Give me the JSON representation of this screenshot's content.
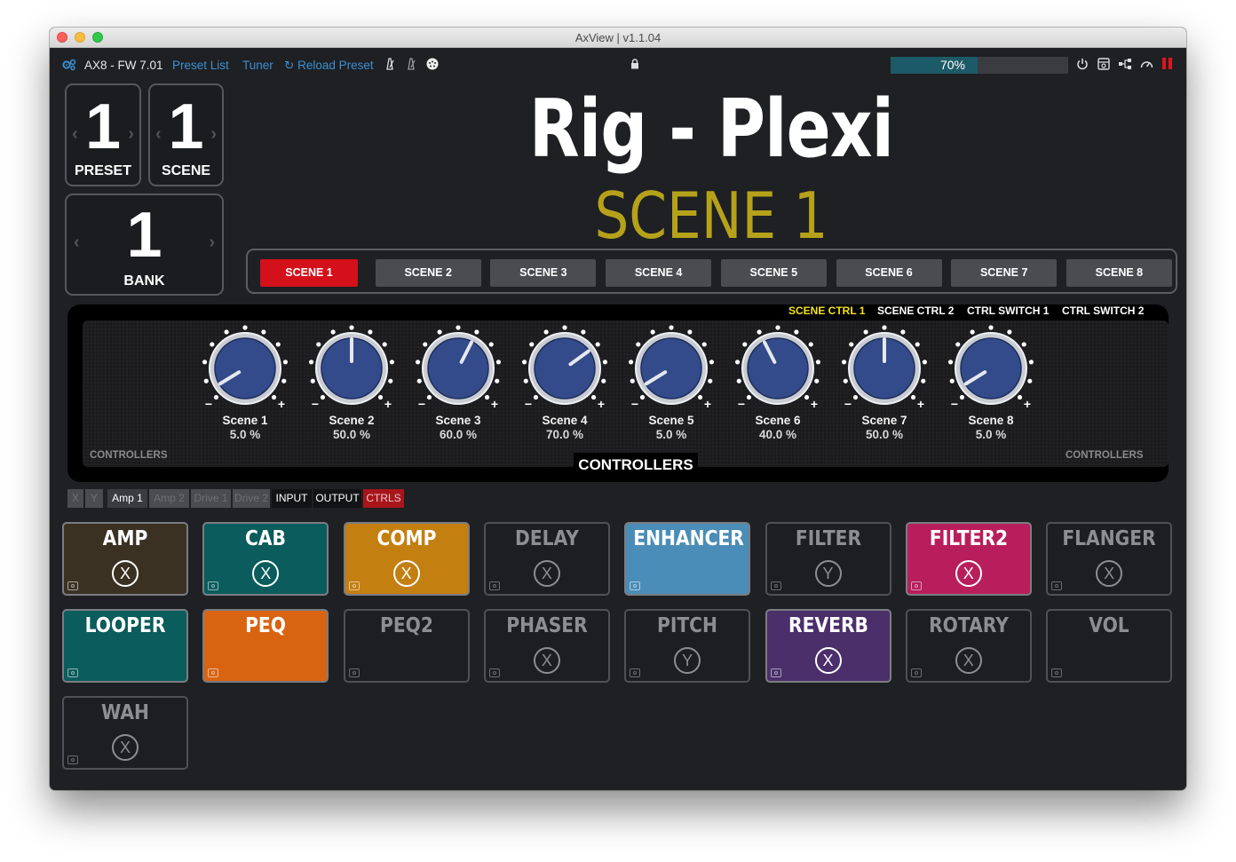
{
  "window": {
    "title": "AxView | v1.1.04"
  },
  "toolbar": {
    "device": "AX8 - FW 7.01",
    "preset_list": "Preset List",
    "tuner": "Tuner",
    "reload_icon": "refresh-icon",
    "reload_label": "Reload Preset",
    "progress_label": "70%",
    "progress_value": 70,
    "accent": "#3d8fd4"
  },
  "preset": {
    "value": "1",
    "label": "PRESET"
  },
  "scene": {
    "value": "1",
    "label": "SCENE"
  },
  "bank": {
    "value": "1",
    "label": "BANK"
  },
  "preset_name": "Rig - Plexi",
  "scene_name": "SCENE 1",
  "scene_buttons": [
    "SCENE 1",
    "SCENE 2",
    "SCENE 3",
    "SCENE 4",
    "SCENE 5",
    "SCENE 6",
    "SCENE 7",
    "SCENE 8"
  ],
  "scene_active_index": 0,
  "controller_tabs": [
    {
      "label": "SCENE CTRL 1",
      "active": true
    },
    {
      "label": "SCENE CTRL 2",
      "active": false
    },
    {
      "label": "CTRL SWITCH 1",
      "active": false
    },
    {
      "label": "CTRL SWITCH 2",
      "active": false
    }
  ],
  "controllers": {
    "corner_left": "CONTROLLERS",
    "corner_right": "CONTROLLERS",
    "center_label": "CONTROLLERS",
    "knobs": [
      {
        "label": "Scene 1",
        "value_text": "5.0 %",
        "value": 5.0
      },
      {
        "label": "Scene 2",
        "value_text": "50.0 %",
        "value": 50.0
      },
      {
        "label": "Scene 3",
        "value_text": "60.0 %",
        "value": 60.0
      },
      {
        "label": "Scene 4",
        "value_text": "70.0 %",
        "value": 70.0
      },
      {
        "label": "Scene 5",
        "value_text": "5.0 %",
        "value": 5.0
      },
      {
        "label": "Scene 6",
        "value_text": "40.0 %",
        "value": 40.0
      },
      {
        "label": "Scene 7",
        "value_text": "50.0 %",
        "value": 50.0
      },
      {
        "label": "Scene 8",
        "value_text": "5.0 %",
        "value": 5.0
      }
    ]
  },
  "chips": [
    {
      "label": "X",
      "state": "dim"
    },
    {
      "label": "Y",
      "state": "dim"
    },
    {
      "label": "Amp 1",
      "state": "on"
    },
    {
      "label": "Amp 2",
      "state": "dim"
    },
    {
      "label": "Drive 1",
      "state": "dim"
    },
    {
      "label": "Drive 2",
      "state": "dim"
    },
    {
      "label": "INPUT",
      "state": "plain"
    },
    {
      "label": "OUTPUT",
      "state": "plain"
    },
    {
      "label": "CTRLS",
      "state": "red"
    }
  ],
  "blocks": [
    {
      "name": "AMP",
      "xy": "X",
      "color": "#3b3122",
      "on": true
    },
    {
      "name": "CAB",
      "xy": "X",
      "color": "#0b5c5c",
      "on": true
    },
    {
      "name": "COMP",
      "xy": "X",
      "color": "#c47f11",
      "on": true
    },
    {
      "name": "DELAY",
      "xy": "X",
      "color": "",
      "on": false
    },
    {
      "name": "ENHANCER",
      "xy": "",
      "color": "#4a8db8",
      "on": true
    },
    {
      "name": "FILTER",
      "xy": "Y",
      "color": "",
      "on": false
    },
    {
      "name": "FILTER2",
      "xy": "X",
      "color": "#b81e5c",
      "on": true
    },
    {
      "name": "FLANGER",
      "xy": "X",
      "color": "",
      "on": false
    },
    {
      "name": "LOOPER",
      "xy": "",
      "color": "#0b5c5c",
      "on": true
    },
    {
      "name": "PEQ",
      "xy": "",
      "color": "#d86412",
      "on": true
    },
    {
      "name": "PEQ2",
      "xy": "",
      "color": "",
      "on": false
    },
    {
      "name": "PHASER",
      "xy": "X",
      "color": "",
      "on": false
    },
    {
      "name": "PITCH",
      "xy": "Y",
      "color": "",
      "on": false
    },
    {
      "name": "REVERB",
      "xy": "X",
      "color": "#4a2f6b",
      "on": true
    },
    {
      "name": "ROTARY",
      "xy": "X",
      "color": "",
      "on": false
    },
    {
      "name": "VOL",
      "xy": "",
      "color": "",
      "on": false
    },
    {
      "name": "WAH",
      "xy": "X",
      "color": "",
      "on": false
    }
  ]
}
